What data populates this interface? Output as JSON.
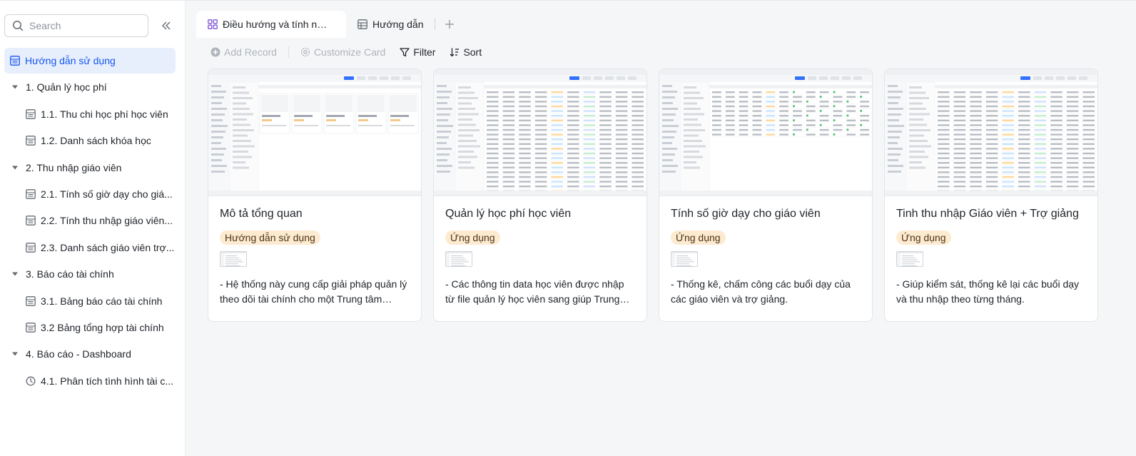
{
  "sidebar": {
    "search": {
      "placeholder": "Search"
    },
    "items": [
      {
        "label": "Hướng dẫn sử dụng",
        "type": "table",
        "level": 0,
        "active": true
      },
      {
        "label": "1. Quản lý học phí",
        "type": "folder",
        "level": 0
      },
      {
        "label": "1.1. Thu chi học phí học viên",
        "type": "table",
        "level": 1
      },
      {
        "label": "1.2. Danh sách khóa học",
        "type": "table",
        "level": 1
      },
      {
        "label": "2. Thu nhập giáo viên",
        "type": "folder",
        "level": 0
      },
      {
        "label": "2.1. Tính số giờ dạy cho giá...",
        "type": "table",
        "level": 1
      },
      {
        "label": "2.2. Tính thu nhập giáo viên...",
        "type": "table",
        "level": 1
      },
      {
        "label": "2.3. Danh sách giáo viên trợ...",
        "type": "table",
        "level": 1
      },
      {
        "label": "3. Báo cáo tài chính",
        "type": "folder",
        "level": 0
      },
      {
        "label": "3.1. Bảng báo cáo tài chính",
        "type": "table",
        "level": 1
      },
      {
        "label": "3.2 Bảng tổng hợp tài chính",
        "type": "table",
        "level": 1
      },
      {
        "label": "4. Báo cáo - Dashboard",
        "type": "folder",
        "level": 0
      },
      {
        "label": "4.1. Phân tích tình hình tài c...",
        "type": "dashboard",
        "level": 1
      }
    ]
  },
  "tabs": [
    {
      "label": "Điều hướng và tính nă...",
      "icon": "gallery-icon",
      "active": true
    },
    {
      "label": "Hướng dẫn",
      "icon": "grid-icon",
      "active": false
    }
  ],
  "toolbar": {
    "add_record": "Add Record",
    "customize_card": "Customize Card",
    "filter": "Filter",
    "sort": "Sort"
  },
  "cards": [
    {
      "title": "Mô tả tổng quan",
      "tag": "Hướng dẫn sử dụng",
      "desc": "- Hệ thống này cung cấp giải pháp quản lý theo dõi tài chính cho một Trung tâm đào..."
    },
    {
      "title": "Quản lý học phí học viên",
      "tag": "Ứng dụng",
      "desc": "- Các thông tin data học viên được nhập từ file quản lý học viên sang giúp Trung tâm..."
    },
    {
      "title": "Tính số giờ dạy cho giáo viên",
      "tag": "Ứng dụng",
      "desc": "- Thống kê, chấm công các buổi dạy của các giáo viên và trợ giảng."
    },
    {
      "title": "Tinh thu nhập Giáo viên + Trợ giảng",
      "tag": "Ứng dụng",
      "desc": "- Giúp kiểm sát, thống kê lại các buổi dạy và thu nhập theo từng tháng."
    }
  ],
  "colors": {
    "accent": "#1456f0",
    "active_bg": "#e8effc",
    "tag_bg": "#fdebd1",
    "main_bg": "#f5f6f7"
  }
}
